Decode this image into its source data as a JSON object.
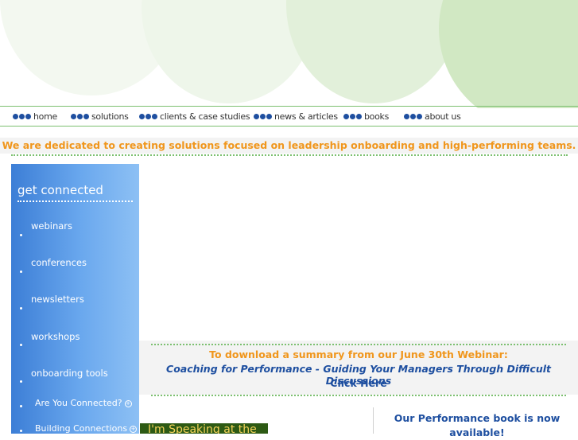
{
  "nav": {
    "items": [
      {
        "label": "home"
      },
      {
        "label": "solutions"
      },
      {
        "label": "clients & case studies"
      },
      {
        "label": "news & articles"
      },
      {
        "label": "books"
      },
      {
        "label": "about us"
      }
    ]
  },
  "tagline": "We are dedicated to creating solutions focused on leadership onboarding and high-performing teams.",
  "sidebar": {
    "title": "get connected",
    "links": [
      "webinars",
      "conferences",
      "newsletters",
      "workshops",
      "onboarding tools"
    ],
    "sublinks": [
      "Are You Connected?",
      "Building Connections"
    ]
  },
  "webinar": {
    "line1": "To download a summary from our June 30th Webinar:",
    "line2": "Coaching for Performance - Guiding Your Managers Through Difficult Discussions",
    "line3": "Click Here"
  },
  "promo": {
    "speaking": "I'm Speaking at the",
    "book_line1": "Our Performance book is now",
    "book_line2": "available!"
  },
  "colors": {
    "accent_orange": "#f0961c",
    "link_blue": "#1e4fa0",
    "line_green": "#7cc070"
  }
}
